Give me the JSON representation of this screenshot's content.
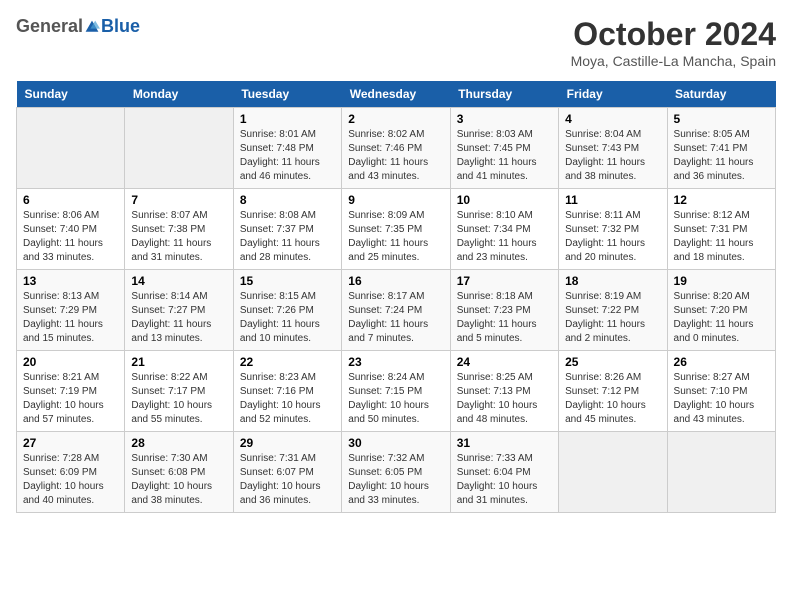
{
  "header": {
    "logo_general": "General",
    "logo_blue": "Blue",
    "month_title": "October 2024",
    "location": "Moya, Castille-La Mancha, Spain"
  },
  "weekdays": [
    "Sunday",
    "Monday",
    "Tuesday",
    "Wednesday",
    "Thursday",
    "Friday",
    "Saturday"
  ],
  "weeks": [
    [
      {
        "day": "",
        "sunrise": "",
        "sunset": "",
        "daylight": ""
      },
      {
        "day": "",
        "sunrise": "",
        "sunset": "",
        "daylight": ""
      },
      {
        "day": "1",
        "sunrise": "Sunrise: 8:01 AM",
        "sunset": "Sunset: 7:48 PM",
        "daylight": "Daylight: 11 hours and 46 minutes."
      },
      {
        "day": "2",
        "sunrise": "Sunrise: 8:02 AM",
        "sunset": "Sunset: 7:46 PM",
        "daylight": "Daylight: 11 hours and 43 minutes."
      },
      {
        "day": "3",
        "sunrise": "Sunrise: 8:03 AM",
        "sunset": "Sunset: 7:45 PM",
        "daylight": "Daylight: 11 hours and 41 minutes."
      },
      {
        "day": "4",
        "sunrise": "Sunrise: 8:04 AM",
        "sunset": "Sunset: 7:43 PM",
        "daylight": "Daylight: 11 hours and 38 minutes."
      },
      {
        "day": "5",
        "sunrise": "Sunrise: 8:05 AM",
        "sunset": "Sunset: 7:41 PM",
        "daylight": "Daylight: 11 hours and 36 minutes."
      }
    ],
    [
      {
        "day": "6",
        "sunrise": "Sunrise: 8:06 AM",
        "sunset": "Sunset: 7:40 PM",
        "daylight": "Daylight: 11 hours and 33 minutes."
      },
      {
        "day": "7",
        "sunrise": "Sunrise: 8:07 AM",
        "sunset": "Sunset: 7:38 PM",
        "daylight": "Daylight: 11 hours and 31 minutes."
      },
      {
        "day": "8",
        "sunrise": "Sunrise: 8:08 AM",
        "sunset": "Sunset: 7:37 PM",
        "daylight": "Daylight: 11 hours and 28 minutes."
      },
      {
        "day": "9",
        "sunrise": "Sunrise: 8:09 AM",
        "sunset": "Sunset: 7:35 PM",
        "daylight": "Daylight: 11 hours and 25 minutes."
      },
      {
        "day": "10",
        "sunrise": "Sunrise: 8:10 AM",
        "sunset": "Sunset: 7:34 PM",
        "daylight": "Daylight: 11 hours and 23 minutes."
      },
      {
        "day": "11",
        "sunrise": "Sunrise: 8:11 AM",
        "sunset": "Sunset: 7:32 PM",
        "daylight": "Daylight: 11 hours and 20 minutes."
      },
      {
        "day": "12",
        "sunrise": "Sunrise: 8:12 AM",
        "sunset": "Sunset: 7:31 PM",
        "daylight": "Daylight: 11 hours and 18 minutes."
      }
    ],
    [
      {
        "day": "13",
        "sunrise": "Sunrise: 8:13 AM",
        "sunset": "Sunset: 7:29 PM",
        "daylight": "Daylight: 11 hours and 15 minutes."
      },
      {
        "day": "14",
        "sunrise": "Sunrise: 8:14 AM",
        "sunset": "Sunset: 7:27 PM",
        "daylight": "Daylight: 11 hours and 13 minutes."
      },
      {
        "day": "15",
        "sunrise": "Sunrise: 8:15 AM",
        "sunset": "Sunset: 7:26 PM",
        "daylight": "Daylight: 11 hours and 10 minutes."
      },
      {
        "day": "16",
        "sunrise": "Sunrise: 8:17 AM",
        "sunset": "Sunset: 7:24 PM",
        "daylight": "Daylight: 11 hours and 7 minutes."
      },
      {
        "day": "17",
        "sunrise": "Sunrise: 8:18 AM",
        "sunset": "Sunset: 7:23 PM",
        "daylight": "Daylight: 11 hours and 5 minutes."
      },
      {
        "day": "18",
        "sunrise": "Sunrise: 8:19 AM",
        "sunset": "Sunset: 7:22 PM",
        "daylight": "Daylight: 11 hours and 2 minutes."
      },
      {
        "day": "19",
        "sunrise": "Sunrise: 8:20 AM",
        "sunset": "Sunset: 7:20 PM",
        "daylight": "Daylight: 11 hours and 0 minutes."
      }
    ],
    [
      {
        "day": "20",
        "sunrise": "Sunrise: 8:21 AM",
        "sunset": "Sunset: 7:19 PM",
        "daylight": "Daylight: 10 hours and 57 minutes."
      },
      {
        "day": "21",
        "sunrise": "Sunrise: 8:22 AM",
        "sunset": "Sunset: 7:17 PM",
        "daylight": "Daylight: 10 hours and 55 minutes."
      },
      {
        "day": "22",
        "sunrise": "Sunrise: 8:23 AM",
        "sunset": "Sunset: 7:16 PM",
        "daylight": "Daylight: 10 hours and 52 minutes."
      },
      {
        "day": "23",
        "sunrise": "Sunrise: 8:24 AM",
        "sunset": "Sunset: 7:15 PM",
        "daylight": "Daylight: 10 hours and 50 minutes."
      },
      {
        "day": "24",
        "sunrise": "Sunrise: 8:25 AM",
        "sunset": "Sunset: 7:13 PM",
        "daylight": "Daylight: 10 hours and 48 minutes."
      },
      {
        "day": "25",
        "sunrise": "Sunrise: 8:26 AM",
        "sunset": "Sunset: 7:12 PM",
        "daylight": "Daylight: 10 hours and 45 minutes."
      },
      {
        "day": "26",
        "sunrise": "Sunrise: 8:27 AM",
        "sunset": "Sunset: 7:10 PM",
        "daylight": "Daylight: 10 hours and 43 minutes."
      }
    ],
    [
      {
        "day": "27",
        "sunrise": "Sunrise: 7:28 AM",
        "sunset": "Sunset: 6:09 PM",
        "daylight": "Daylight: 10 hours and 40 minutes."
      },
      {
        "day": "28",
        "sunrise": "Sunrise: 7:30 AM",
        "sunset": "Sunset: 6:08 PM",
        "daylight": "Daylight: 10 hours and 38 minutes."
      },
      {
        "day": "29",
        "sunrise": "Sunrise: 7:31 AM",
        "sunset": "Sunset: 6:07 PM",
        "daylight": "Daylight: 10 hours and 36 minutes."
      },
      {
        "day": "30",
        "sunrise": "Sunrise: 7:32 AM",
        "sunset": "Sunset: 6:05 PM",
        "daylight": "Daylight: 10 hours and 33 minutes."
      },
      {
        "day": "31",
        "sunrise": "Sunrise: 7:33 AM",
        "sunset": "Sunset: 6:04 PM",
        "daylight": "Daylight: 10 hours and 31 minutes."
      },
      {
        "day": "",
        "sunrise": "",
        "sunset": "",
        "daylight": ""
      },
      {
        "day": "",
        "sunrise": "",
        "sunset": "",
        "daylight": ""
      }
    ]
  ]
}
